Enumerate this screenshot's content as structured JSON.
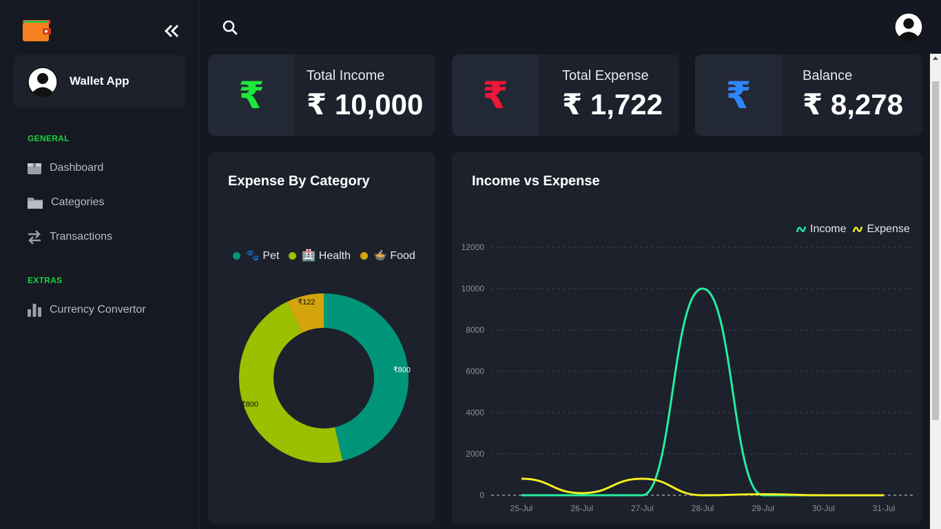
{
  "app": {
    "name": "Wallet App"
  },
  "sidebar": {
    "general_title": "GENERAL",
    "extras_title": "EXTRAS",
    "items": [
      {
        "label": "Dashboard",
        "icon": "box-icon"
      },
      {
        "label": "Categories",
        "icon": "folder-icon"
      },
      {
        "label": "Transactions",
        "icon": "swap-arrows-icon"
      },
      {
        "label": "Currency Convertor",
        "icon": "bar-chart-icon"
      }
    ],
    "collapse_icon": "double-chevron-left-icon"
  },
  "stats": [
    {
      "label": "Total Income",
      "value": "₹ 10,000",
      "symbol": "₹",
      "color": "#1de63d"
    },
    {
      "label": "Total Expense",
      "value": "₹ 1,722",
      "symbol": "₹",
      "color": "#ef1638"
    },
    {
      "label": "Balance",
      "value": "₹ 8,278",
      "symbol": "₹",
      "color": "#2f86f6"
    }
  ],
  "expense_chart": {
    "title": "Expense By Category",
    "legend": [
      {
        "label": "🐾 Pet",
        "color": "#009578"
      },
      {
        "label": "🏥 Health",
        "color": "#9cbf00"
      },
      {
        "label": "🍲 Food",
        "color": "#d4a40b"
      }
    ]
  },
  "income_chart": {
    "title": "Income vs Expense",
    "legend": [
      {
        "label": "Income",
        "color": "#23f0a0"
      },
      {
        "label": "Expense",
        "color": "#f2f21f"
      }
    ]
  },
  "chart_data": [
    {
      "type": "pie",
      "title": "Expense By Category",
      "categories": [
        "🐾 Pet",
        "🏥 Health",
        "🍲 Food"
      ],
      "values": [
        800,
        800,
        122
      ],
      "data_labels": [
        "₹800",
        "₹800",
        "₹122"
      ],
      "colors": [
        "#009578",
        "#9cbf00",
        "#d4a40b"
      ],
      "donut": true,
      "legend": "top"
    },
    {
      "type": "line",
      "title": "Income vs Expense",
      "categories": [
        "25-Jul",
        "26-Jul",
        "27-Jul",
        "28-Jul",
        "29-Jul",
        "30-Jul",
        "31-Jul"
      ],
      "series": [
        {
          "name": "Income",
          "color": "#23f0a0",
          "values": [
            0,
            0,
            0,
            10000,
            0,
            0,
            0
          ]
        },
        {
          "name": "Expense",
          "color": "#f2f21f",
          "values": [
            800,
            100,
            800,
            0,
            50,
            0,
            0
          ]
        }
      ],
      "ylim": [
        0,
        12000
      ],
      "yticks": [
        0,
        2000,
        4000,
        6000,
        8000,
        10000,
        12000
      ],
      "grid": true,
      "legend": "top-right"
    }
  ]
}
